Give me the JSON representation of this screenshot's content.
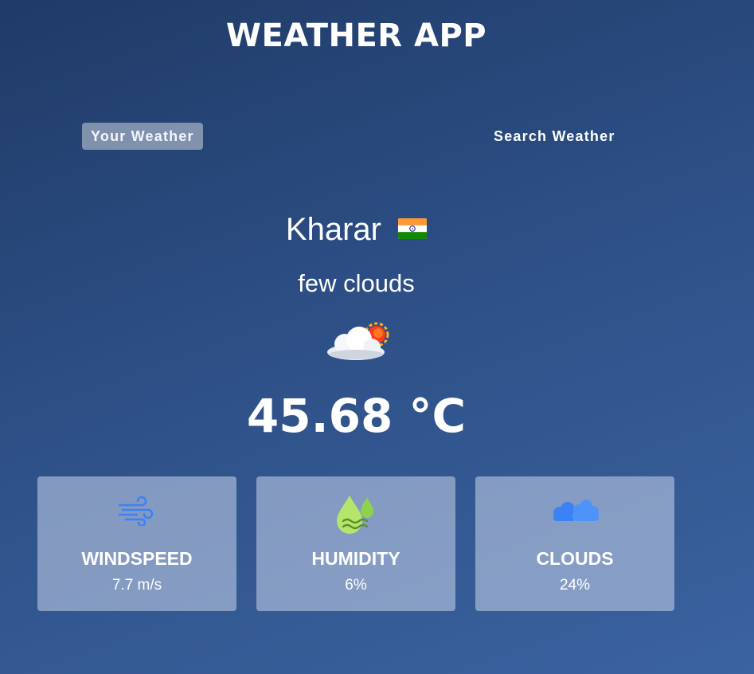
{
  "app": {
    "title": "WEATHER APP"
  },
  "tabs": {
    "your_weather": "Your Weather",
    "search_weather": "Search Weather",
    "active": "your_weather"
  },
  "location": {
    "city": "Kharar",
    "country_flag_icon": "india-flag-icon"
  },
  "current": {
    "description": "few clouds",
    "icon": "few-clouds-icon",
    "temperature": "45.68 °C"
  },
  "stats": {
    "windspeed": {
      "label": "WINDSPEED",
      "value": "7.7 m/s",
      "icon": "wind-icon",
      "icon_color": "#3b82f6"
    },
    "humidity": {
      "label": "HUMIDITY",
      "value": "6%",
      "icon": "humidity-drops-icon",
      "icon_color": "#a3e635"
    },
    "clouds": {
      "label": "CLOUDS",
      "value": "24%",
      "icon": "clouds-icon",
      "icon_color": "#3b82f6"
    }
  },
  "colors": {
    "background_top": "#1f3a66",
    "background_bottom": "#3b63a0",
    "card_bg": "#a9b9d6",
    "active_tab_bg": "#8a9cbd"
  }
}
